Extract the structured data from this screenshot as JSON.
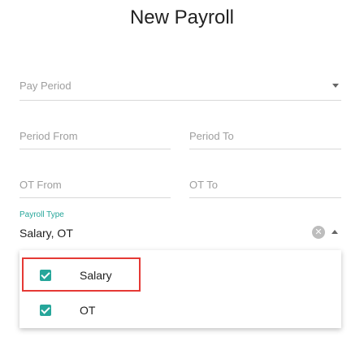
{
  "header": {
    "title": "New Payroll"
  },
  "form": {
    "pay_period": {
      "placeholder": "Pay Period"
    },
    "period_from": {
      "placeholder": "Period From"
    },
    "period_to": {
      "placeholder": "Period To"
    },
    "ot_from": {
      "placeholder": "OT From"
    },
    "ot_to": {
      "placeholder": "OT To"
    },
    "payroll_type": {
      "label": "Payroll Type",
      "value": "Salary, OT",
      "clear_glyph": "✕",
      "options": [
        {
          "label": "Salary",
          "checked": true
        },
        {
          "label": "OT",
          "checked": true
        }
      ]
    }
  },
  "colors": {
    "accent": "#26a69a",
    "highlight": "#e53935"
  }
}
